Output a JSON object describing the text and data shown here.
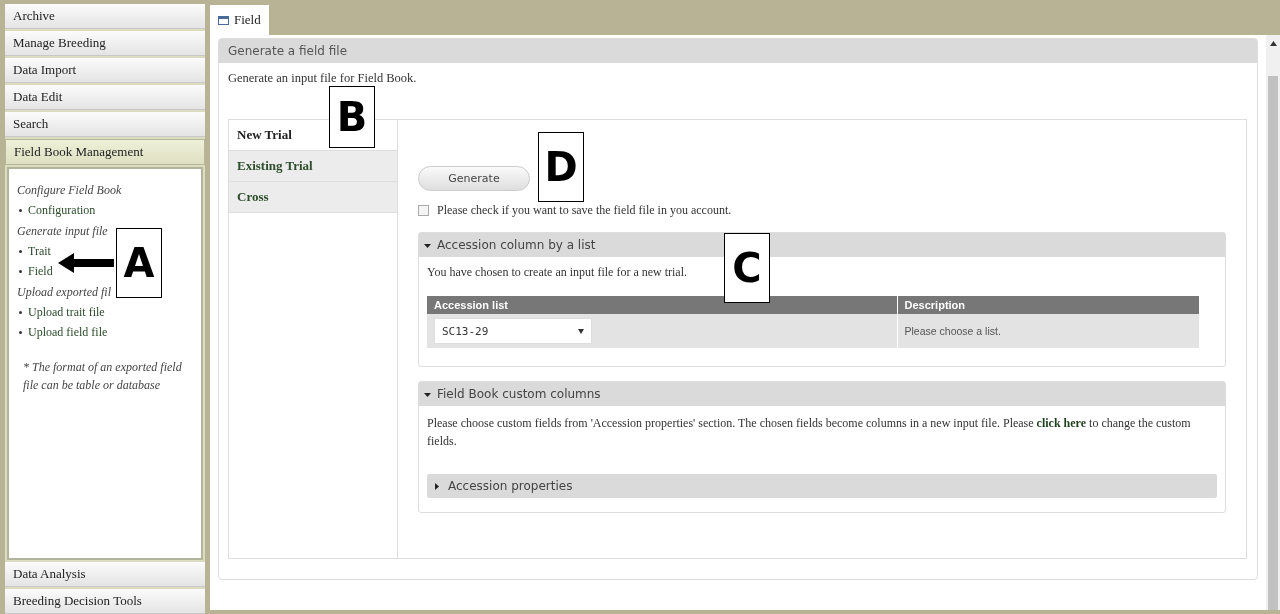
{
  "sidebar": {
    "sections": [
      {
        "label": "Archive",
        "expanded": false
      },
      {
        "label": "Manage Breeding",
        "expanded": false
      },
      {
        "label": "Data Import",
        "expanded": false
      },
      {
        "label": "Data Edit",
        "expanded": false
      },
      {
        "label": "Search",
        "expanded": false
      },
      {
        "label": "Field Book Management",
        "expanded": true,
        "groups": [
          {
            "heading": "Configure Field Book",
            "links": [
              "Configuration"
            ]
          },
          {
            "heading": "Generate input file",
            "links": [
              "Trait",
              "Field"
            ]
          },
          {
            "heading": "Upload exported fil",
            "links": [
              "Upload trait file",
              "Upload field file"
            ]
          }
        ],
        "note": "* The format of an exported field file can be table or database"
      },
      {
        "label": "Data Analysis",
        "expanded": false
      },
      {
        "label": "Breeding Decision Tools",
        "expanded": false
      }
    ]
  },
  "tabs": [
    {
      "label": "Field",
      "selected": true
    }
  ],
  "panel": {
    "title": "Generate a field file",
    "intro": "Generate an input file for Field Book.",
    "trial_tabs": [
      {
        "label": "New Trial",
        "selected": true
      },
      {
        "label": "Existing Trial",
        "selected": false
      },
      {
        "label": "Cross",
        "selected": false
      }
    ],
    "generate_button": "Generate",
    "save_checkbox": {
      "label": "Please check if you want to save the field file in you account.",
      "checked": false
    },
    "accession_section": {
      "title": "Accession column by a list",
      "expanded": true,
      "text": "You have chosen to create an input file for a new trial.",
      "table": {
        "columns": [
          "Accession list",
          "Description"
        ],
        "rows": [
          {
            "select": "SC13-29",
            "description": "Please choose a list."
          }
        ]
      }
    },
    "custom_section": {
      "title": "Field Book custom columns",
      "expanded": true,
      "text_before": "Please choose custom fields from 'Accession properties' section. The chosen fields become columns in a new input file. Please",
      "link": "click here",
      "text_after": "to change the custom fields.",
      "subsection": {
        "title": "Accession properties",
        "expanded": false
      }
    }
  },
  "callouts": [
    {
      "label": "A"
    },
    {
      "label": "B"
    },
    {
      "label": "C"
    },
    {
      "label": "D"
    }
  ]
}
